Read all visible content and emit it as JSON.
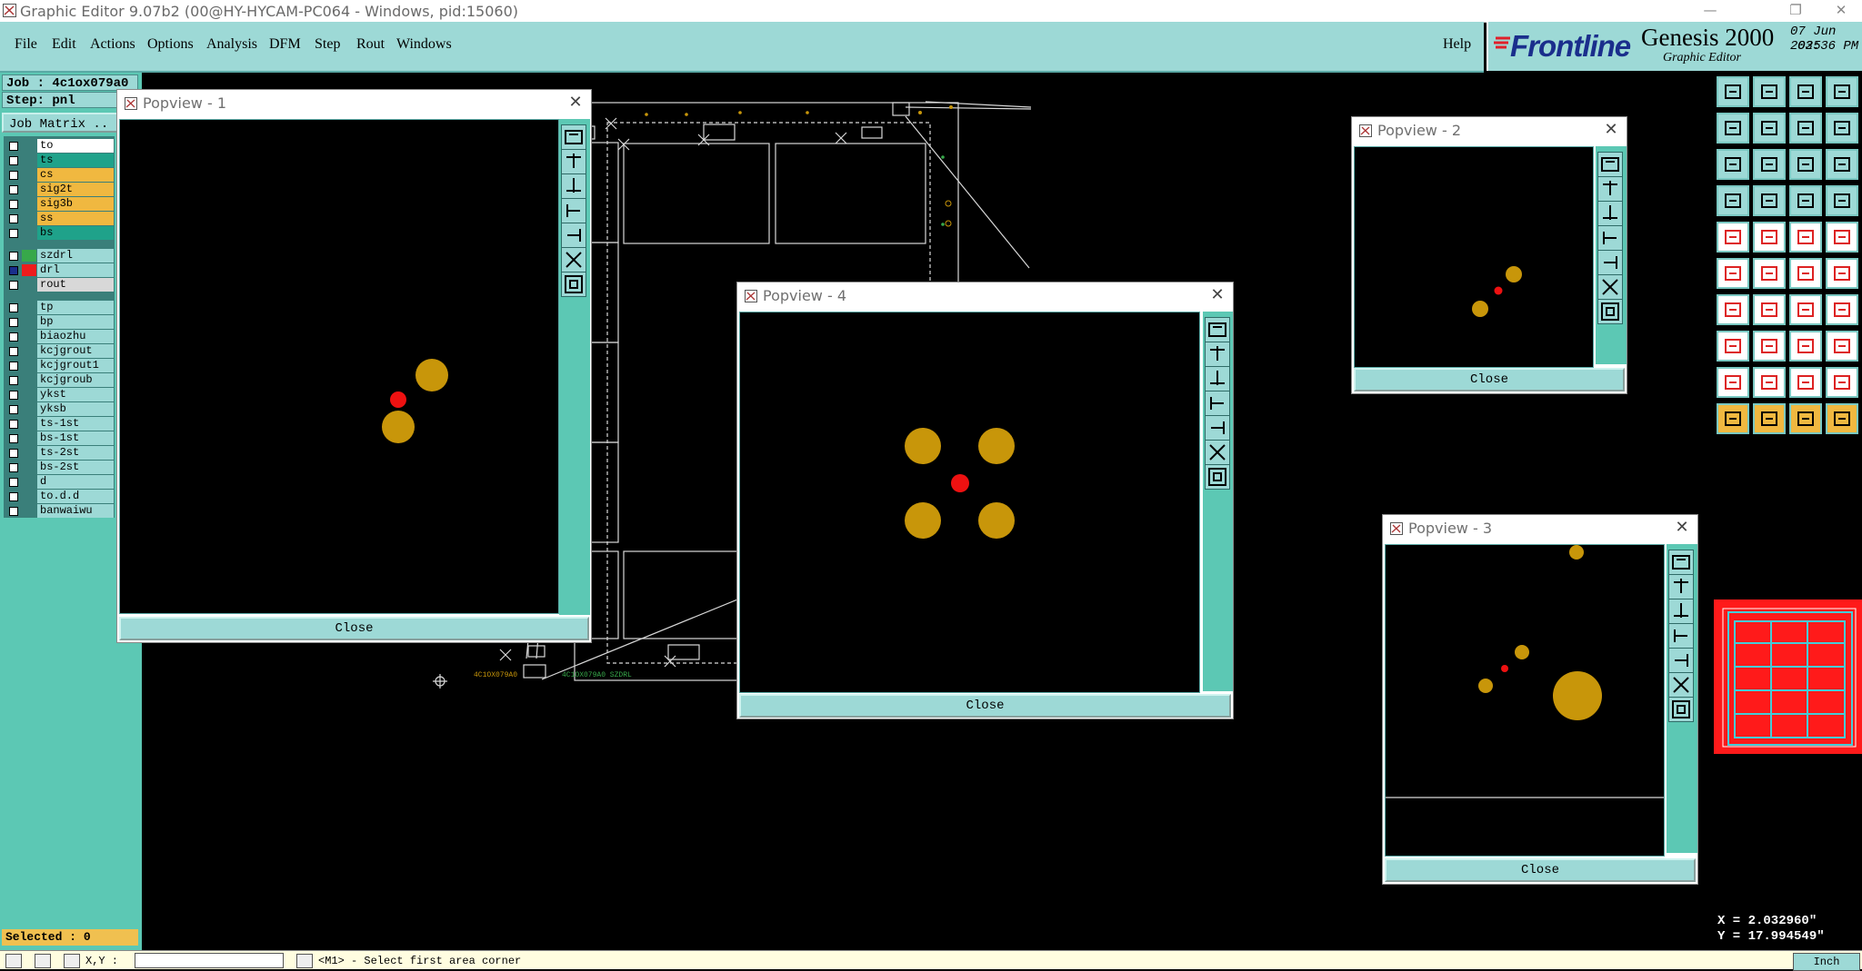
{
  "window": {
    "title": "Graphic Editor 9.07b2 (00@HY-HYCAM-PC064 - Windows, pid:15060)"
  },
  "menu": {
    "items": [
      "File",
      "Edit",
      "Actions",
      "Options",
      "Analysis",
      "DFM",
      "Step",
      "Rout",
      "Windows"
    ],
    "help": "Help"
  },
  "brand": {
    "logo": "Frontline",
    "product": "Genesis 2000",
    "subtitle": "Graphic Editor",
    "date": "07 Jun 2025",
    "time": "03:36 PM"
  },
  "job": {
    "job_line": "Job : 4c1ox079a0",
    "step_line": "Step: pnl",
    "matrix_button": "Job Matrix .."
  },
  "layers": [
    {
      "name": "to",
      "color": "#ffffff"
    },
    {
      "name": "ts",
      "color": "#1fa28a"
    },
    {
      "name": "cs",
      "color": "#f0b840"
    },
    {
      "name": "sig2t",
      "color": "#f0b840"
    },
    {
      "name": "sig3b",
      "color": "#f0b840"
    },
    {
      "name": "ss",
      "color": "#f0b840"
    },
    {
      "name": "bs",
      "color": "#1fa28a"
    },
    {
      "name": "szdrl",
      "color": "#9dd9d6",
      "swatch": "#37a84a"
    },
    {
      "name": "drl",
      "color": "#9dd9d6",
      "swatch": "#ee1c1c",
      "active": true
    },
    {
      "name": "rout",
      "color": "#d8d8d8"
    },
    {
      "name": "tp",
      "color": "#9dd9d6"
    },
    {
      "name": "bp",
      "color": "#9dd9d6"
    },
    {
      "name": "biaozhu",
      "color": "#9dd9d6"
    },
    {
      "name": "kcjgrout",
      "color": "#9dd9d6"
    },
    {
      "name": "kcjgrout1",
      "color": "#9dd9d6"
    },
    {
      "name": "kcjgroub",
      "color": "#9dd9d6"
    },
    {
      "name": "ykst",
      "color": "#9dd9d6"
    },
    {
      "name": "yksb",
      "color": "#9dd9d6"
    },
    {
      "name": "ts-1st",
      "color": "#9dd9d6"
    },
    {
      "name": "bs-1st",
      "color": "#9dd9d6"
    },
    {
      "name": "ts-2st",
      "color": "#9dd9d6"
    },
    {
      "name": "bs-2st",
      "color": "#9dd9d6"
    },
    {
      "name": "d",
      "color": "#9dd9d6"
    },
    {
      "name": "to.d.d",
      "color": "#9dd9d6"
    },
    {
      "name": "banwaiwu",
      "color": "#9dd9d6"
    }
  ],
  "selected": "Selected : 0",
  "popups": {
    "p1": {
      "title": "Popview - 1",
      "close": "Close"
    },
    "p2": {
      "title": "Popview - 2",
      "close": "Close"
    },
    "p3": {
      "title": "Popview - 3",
      "close": "Close"
    },
    "p4": {
      "title": "Popview - 4",
      "close": "Close"
    }
  },
  "board_labels": {
    "left": "4C1OX079A0",
    "right": "4C1OX079A0 SZDRL"
  },
  "coords": {
    "x": "X = 2.032960\"",
    "y": "Y = 17.994549\""
  },
  "status": {
    "xy_label": "X,Y :",
    "message": "<M1> - Select first area corner",
    "units": "Inch"
  },
  "colors": {
    "panel": "#9dd9d6",
    "panel_dark": "#5cc8b4",
    "pad_yellow": "#c8960a",
    "drill_red": "#ee1111"
  }
}
